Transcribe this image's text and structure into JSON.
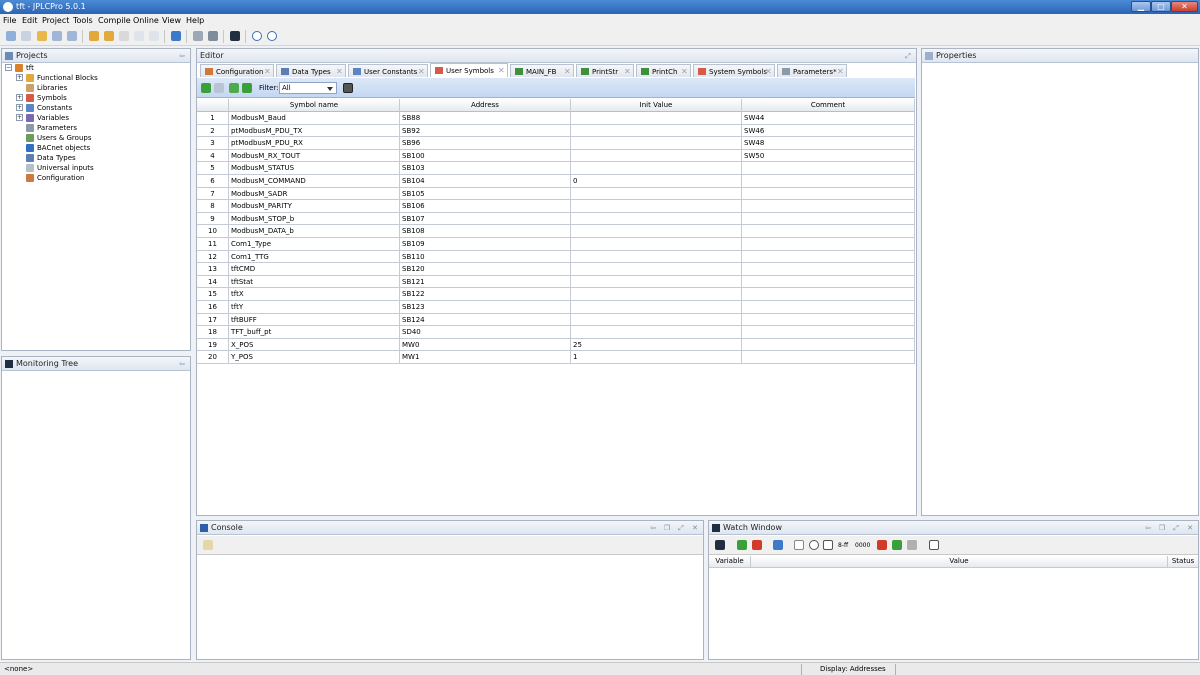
{
  "window": {
    "title": "tft - JPLCPro 5.0.1"
  },
  "menu": [
    "File",
    "Edit",
    "Project",
    "Tools",
    "Compile",
    "Online",
    "View",
    "Help"
  ],
  "projects_panel": {
    "title": "Projects",
    "root": "tft",
    "items": [
      "Functional Blocks",
      "Libraries",
      "Symbols",
      "Constants",
      "Variables",
      "Parameters",
      "Users & Groups",
      "BACnet objects",
      "Data Types",
      "Universal inputs",
      "Configuration"
    ]
  },
  "monitoring_panel": {
    "title": "Monitoring Tree"
  },
  "editor": {
    "title": "Editor",
    "tabs": [
      "Configuration",
      "Data Types",
      "User Constants",
      "User Symbols",
      "MAIN_FB",
      "PrintStr",
      "PrintCh",
      "System Symbols",
      "Parameters*"
    ],
    "active_tab": "User Symbols",
    "filter_label": "Filter:",
    "filter_value": "All",
    "columns": [
      "Symbol name",
      "Address",
      "Init Value",
      "Comment"
    ],
    "rows": [
      [
        "1",
        "ModbusM_Baud",
        "SB88",
        "",
        "SW44"
      ],
      [
        "2",
        "ptModbusM_PDU_TX",
        "SB92",
        "",
        "SW46"
      ],
      [
        "3",
        "ptModbusM_PDU_RX",
        "SB96",
        "",
        "SW48"
      ],
      [
        "4",
        "ModbusM_RX_TOUT",
        "SB100",
        "",
        "SW50"
      ],
      [
        "5",
        "ModbusM_STATUS",
        "SB103",
        "",
        ""
      ],
      [
        "6",
        "ModbusM_COMMAND",
        "SB104",
        "0",
        ""
      ],
      [
        "7",
        "ModbusM_SADR",
        "SB105",
        "",
        ""
      ],
      [
        "8",
        "ModbusM_PARITY",
        "SB106",
        "",
        ""
      ],
      [
        "9",
        "ModbusM_STOP_b",
        "SB107",
        "",
        ""
      ],
      [
        "10",
        "ModbusM_DATA_b",
        "SB108",
        "",
        ""
      ],
      [
        "11",
        "Com1_Type",
        "SB109",
        "",
        ""
      ],
      [
        "12",
        "Com1_TTG",
        "SB110",
        "",
        ""
      ],
      [
        "13",
        "tftCMD",
        "SB120",
        "",
        ""
      ],
      [
        "14",
        "tftStat",
        "SB121",
        "",
        ""
      ],
      [
        "15",
        "tftX",
        "SB122",
        "",
        ""
      ],
      [
        "16",
        "tftY",
        "SB123",
        "",
        ""
      ],
      [
        "17",
        "tftBUFF",
        "SB124",
        "",
        ""
      ],
      [
        "18",
        "TFT_buff_pt",
        "SD40",
        "",
        ""
      ],
      [
        "19",
        "X_POS",
        "MW0",
        "25",
        ""
      ],
      [
        "20",
        "Y_POS",
        "MW1",
        "1",
        ""
      ]
    ]
  },
  "properties_panel": {
    "title": "Properties"
  },
  "console_panel": {
    "title": "Console"
  },
  "watch_panel": {
    "title": "Watch Window",
    "columns": [
      "Variable",
      "Value",
      "Status"
    ],
    "bits_label": "8-ff",
    "hex_label": "0000"
  },
  "statusbar": {
    "left": "<none>",
    "display": "Display: Addresses"
  }
}
